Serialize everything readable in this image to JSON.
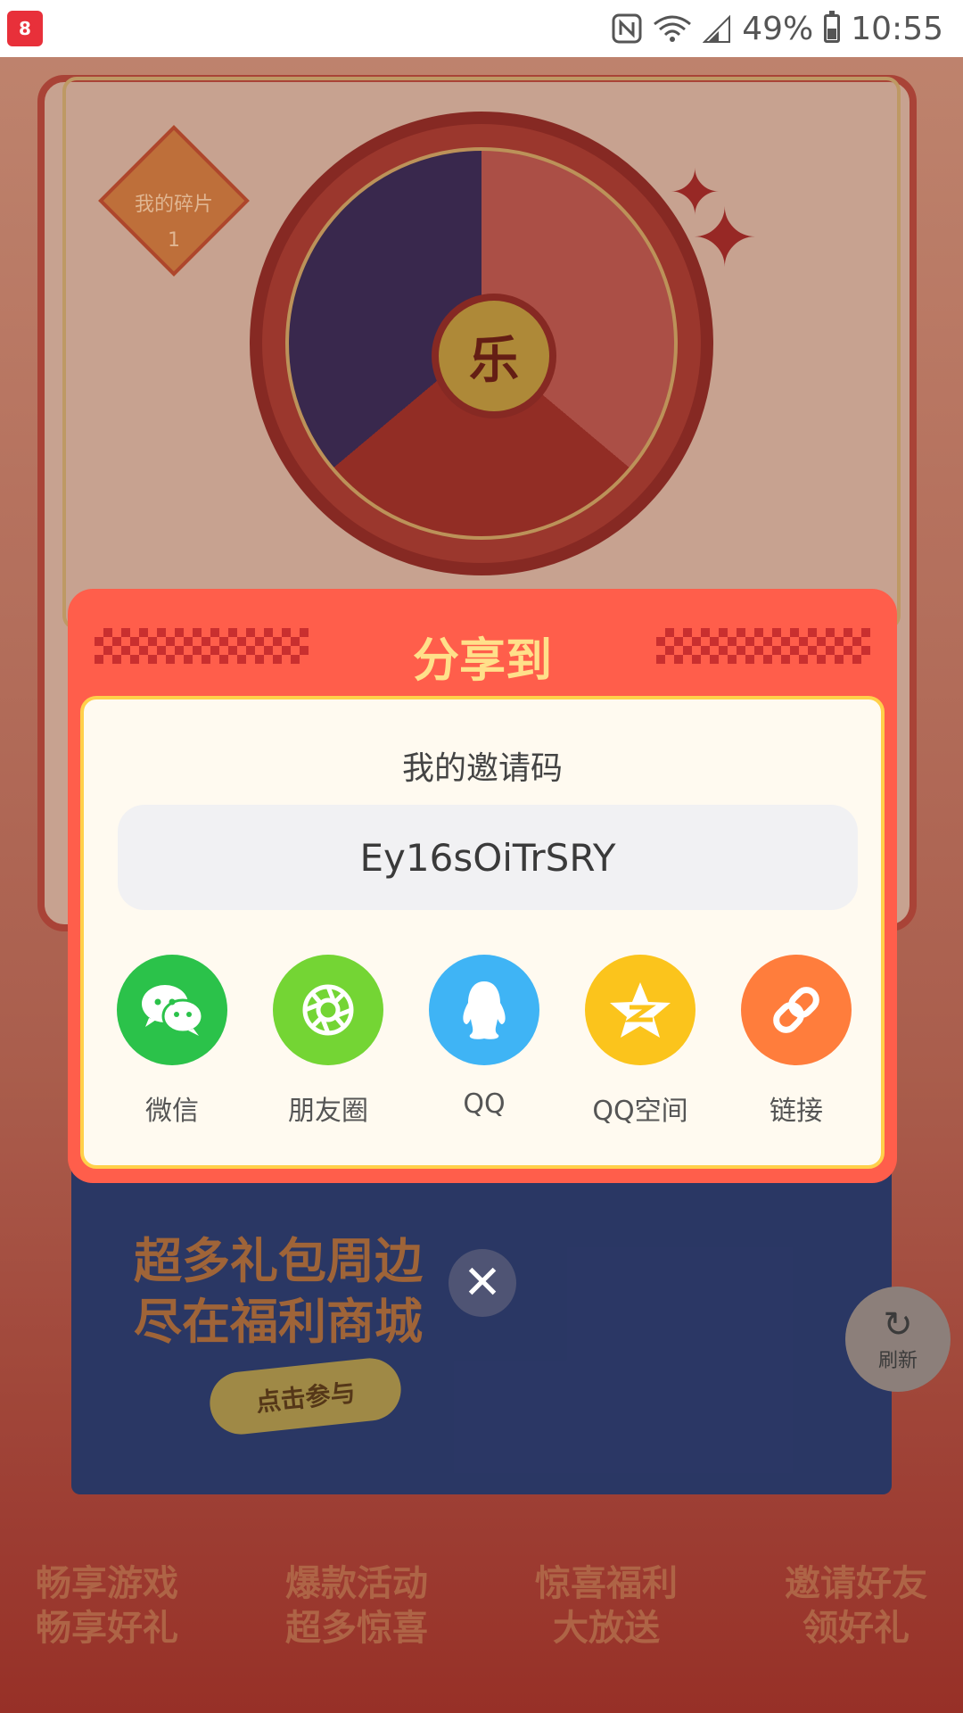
{
  "status_bar": {
    "app_icon_text": "8",
    "battery_percent": "49%",
    "time": "10:55"
  },
  "background": {
    "fragments_label": "我的碎片",
    "fragments_count": "1",
    "wheel_center": "乐",
    "banner_title_line1": "超多礼包周边",
    "banner_title_line2": "尽在福利商城",
    "banner_button": "点击参与",
    "footer": [
      {
        "line1": "畅享游戏",
        "line2": "畅享好礼"
      },
      {
        "line1": "爆款活动",
        "line2": "超多惊喜"
      },
      {
        "line1": "惊喜福利",
        "line2": "大放送"
      },
      {
        "line1": "邀请好友",
        "line2": "领好礼"
      }
    ]
  },
  "refresh": {
    "label": "刷新"
  },
  "share_dialog": {
    "title": "分享到",
    "invite_label": "我的邀请码",
    "invite_code": "Ey16sOiTrSRY",
    "targets": [
      {
        "label": "微信",
        "icon": "wechat-icon",
        "color": "#2bc24a"
      },
      {
        "label": "朋友圈",
        "icon": "moments-icon",
        "color": "#74d534"
      },
      {
        "label": "QQ",
        "icon": "qq-icon",
        "color": "#3fb4f5"
      },
      {
        "label": "QQ空间",
        "icon": "qzone-icon",
        "color": "#fbc41c"
      },
      {
        "label": "链接",
        "icon": "link-icon",
        "color": "#ff7d3c"
      }
    ],
    "close_icon": "close-icon"
  }
}
